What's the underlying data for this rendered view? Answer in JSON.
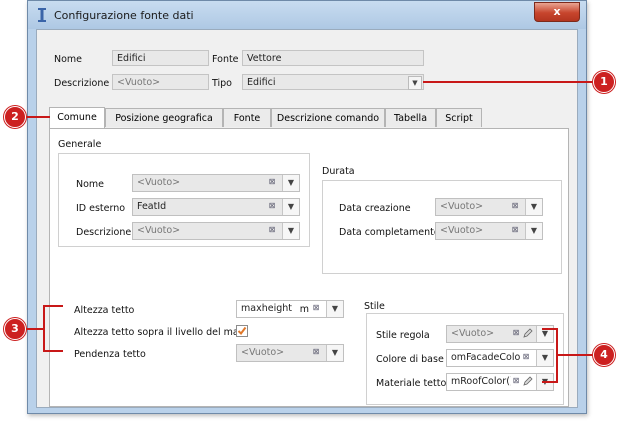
{
  "window": {
    "title": "Configurazione fonte dati",
    "close_glyph": "x"
  },
  "header": {
    "nome_label": "Nome",
    "nome_value": "Edifici",
    "fonte_label": "Fonte",
    "fonte_value": "Vettore",
    "descrizione_label": "Descrizione",
    "descrizione_value": "<Vuoto>",
    "tipo_label": "Tipo",
    "tipo_value": "Edifici"
  },
  "tabs": [
    {
      "label": "Comune",
      "active": true
    },
    {
      "label": "Posizione geografica"
    },
    {
      "label": "Fonte"
    },
    {
      "label": "Descrizione comando"
    },
    {
      "label": "Tabella"
    },
    {
      "label": "Script"
    }
  ],
  "generale": {
    "title": "Generale",
    "nome_label": "Nome",
    "nome_value": "<Vuoto>",
    "id_label": "ID esterno",
    "id_value": "FeatId",
    "descrizione_label": "Descrizione",
    "descrizione_value": "<Vuoto>"
  },
  "durata": {
    "title": "Durata",
    "creazione_label": "Data creazione",
    "creazione_value": "<Vuoto>",
    "completamento_label": "Data completamento",
    "completamento_value": "<Vuoto>"
  },
  "altezza": {
    "tetto_label": "Altezza tetto",
    "tetto_value": "maxheight",
    "tetto_unit": "m",
    "mare_label": "Altezza tetto sopra il livello del mare",
    "mare_checked": true,
    "pendenza_label": "Pendenza tetto",
    "pendenza_value": "<Vuoto>"
  },
  "stile": {
    "title": "Stile",
    "regola_label": "Stile regola",
    "regola_value": "<Vuoto>",
    "colore_label": "Colore di base",
    "colore_value": "omFacadeColor()",
    "materiale_label": "Materiale tetto",
    "materiale_value": "mRoofColor()"
  },
  "callouts": [
    "1",
    "2",
    "3",
    "4"
  ],
  "colors": {
    "callout": "#cc2020",
    "titlebar": "#b9d1ea",
    "checkbox_check": "#e0782a"
  }
}
